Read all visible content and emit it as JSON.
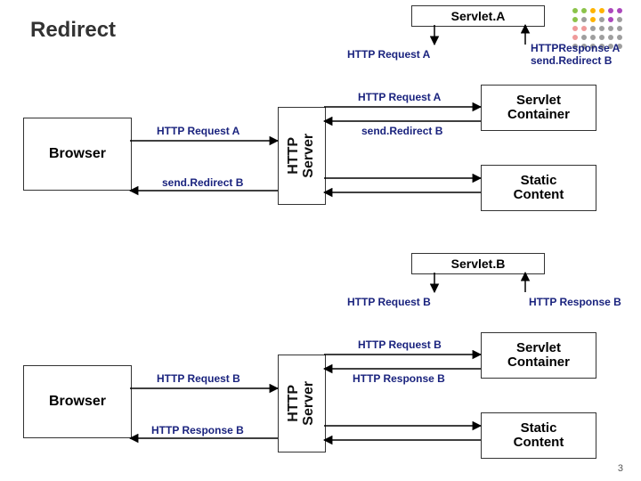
{
  "slide": {
    "title": "Redirect",
    "number": "3"
  },
  "blockA": {
    "servletALabel": "Servlet.A",
    "reqA_top": "HTTP Request A",
    "respA_top": "HTTPResponse A\nsend.Redirect B",
    "browser": "Browser",
    "reqA_left_top": "HTTP Request A",
    "reqA_left_bot": "send.Redirect B",
    "reqA_mid_top": "HTTP Request A",
    "reqA_mid_bot": "send.Redirect B",
    "httpServer": "HTTP\nServer",
    "servletContainer": "Servlet\nContainer",
    "staticContent": "Static\nContent"
  },
  "blockB": {
    "servletBLabel": "Servlet.B",
    "reqB_top": "HTTP Request B",
    "respB_top": "HTTP Response B",
    "browser": "Browser",
    "reqB_left_top": "HTTP Request B",
    "reqB_left_bot": "HTTP Response B",
    "reqB_mid_top": "HTTP Request B",
    "reqB_mid_bot": "HTTP Response B",
    "httpServer": "HTTP\nServer",
    "servletContainer": "Servlet\nContainer",
    "staticContent": "Static\nContent"
  },
  "colors": {
    "dotColors": [
      "#8bc34a",
      "#ffb300",
      "#ab47bc",
      "#ef9a9a",
      "#9e9e9e"
    ]
  }
}
